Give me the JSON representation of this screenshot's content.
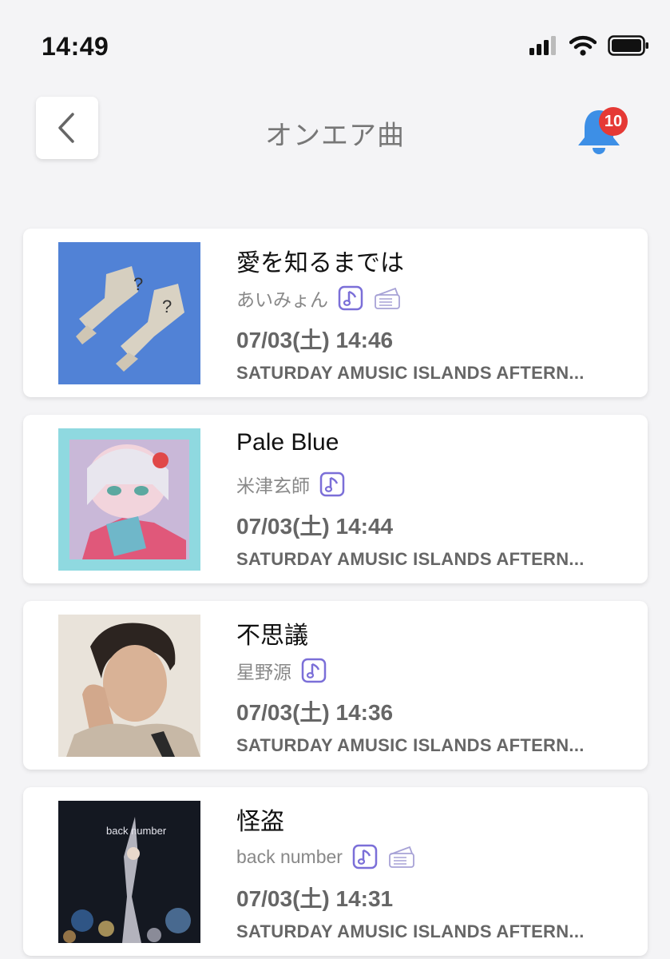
{
  "status_bar": {
    "time": "14:49",
    "icons": [
      "cellular-signal-icon",
      "wifi-icon",
      "battery-icon"
    ]
  },
  "header": {
    "back_icon": "chevron-left-icon",
    "title": "オンエア曲",
    "bell_icon": "bell-icon",
    "notification_count": "10"
  },
  "colors": {
    "accent": "#3d8fe6",
    "icon_purple": "#7b6fd8",
    "badge": "#e53935",
    "background": "#f4f4f6"
  },
  "songs": [
    {
      "title": "愛を知るまでは",
      "artist": "あいみょん",
      "icons": [
        "music-note-icon",
        "ticket-icon"
      ],
      "datetime": "07/03(土) 14:46",
      "program": "SATURDAY AMUSIC ISLANDS AFTERN...",
      "art": "album-art-socks"
    },
    {
      "title": "Pale Blue",
      "artist": "米津玄師",
      "icons": [
        "music-note-icon"
      ],
      "datetime": "07/03(土) 14:44",
      "program": "SATURDAY AMUSIC ISLANDS AFTERN...",
      "art": "album-art-illustration"
    },
    {
      "title": "不思議",
      "artist": "星野源",
      "icons": [
        "music-note-icon"
      ],
      "datetime": "07/03(土) 14:36",
      "program": "SATURDAY AMUSIC ISLANDS AFTERN...",
      "art": "album-art-portrait"
    },
    {
      "title": "怪盗",
      "artist": "back number",
      "icons": [
        "music-note-icon",
        "ticket-icon"
      ],
      "datetime": "07/03(土) 14:31",
      "program": "SATURDAY AMUSIC ISLANDS AFTERN...",
      "art": "album-art-back-number",
      "art_text": "back number"
    }
  ]
}
